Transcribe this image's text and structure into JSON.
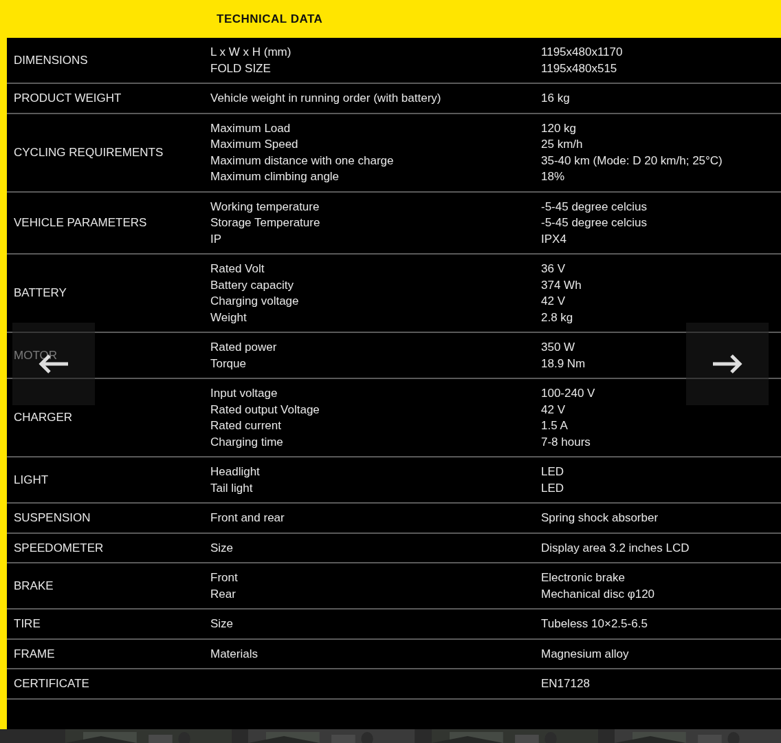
{
  "title": "TECHNICAL DATA",
  "rows": [
    {
      "label": "DIMENSIONS",
      "params": [
        "L x W x H (mm)",
        "FOLD SIZE"
      ],
      "values": [
        "1195x480x1170",
        "1195x480x515"
      ]
    },
    {
      "label": "PRODUCT WEIGHT",
      "params": [
        "Vehicle weight in running order (with battery)"
      ],
      "values": [
        "16 kg"
      ]
    },
    {
      "label": "CYCLING REQUIREMENTS",
      "params": [
        "Maximum Load",
        "Maximum Speed",
        "Maximum distance with one charge",
        "Maximum climbing angle"
      ],
      "values": [
        "120 kg",
        "25 km/h",
        "35-40 km (Mode: D 20 km/h; 25°C)",
        "18%"
      ]
    },
    {
      "label": "VEHICLE PARAMETERS",
      "params": [
        "Working temperature",
        "Storage Temperature",
        "IP"
      ],
      "values": [
        "-5-45 degree celcius",
        "-5-45 degree celcius",
        "IPX4"
      ]
    },
    {
      "label": "BATTERY",
      "params": [
        "Rated Volt",
        "Battery capacity",
        "Charging voltage",
        "Weight"
      ],
      "values": [
        "36 V",
        "374 Wh",
        "42 V",
        "2.8 kg"
      ]
    },
    {
      "label": "MOTOR",
      "params": [
        "Rated power",
        "Torque"
      ],
      "values": [
        "350 W",
        "18.9 Nm"
      ]
    },
    {
      "label": "CHARGER",
      "params": [
        "Input voltage",
        "Rated output Voltage",
        "Rated current",
        "Charging time"
      ],
      "values": [
        "100-240 V",
        "42 V",
        "1.5 A",
        "7-8 hours"
      ]
    },
    {
      "label": "LIGHT",
      "params": [
        "Headlight",
        "Tail light"
      ],
      "values": [
        "LED",
        "LED"
      ]
    },
    {
      "label": "SUSPENSION",
      "params": [
        "Front and rear"
      ],
      "values": [
        "Spring shock absorber"
      ]
    },
    {
      "label": "SPEEDOMETER",
      "params": [
        "Size"
      ],
      "values": [
        "Display area 3.2 inches LCD"
      ]
    },
    {
      "label": "BRAKE",
      "params": [
        "Front",
        "Rear"
      ],
      "values": [
        "Electronic brake",
        "Mechanical disc  φ120"
      ]
    },
    {
      "label": "TIRE",
      "params": [
        "Size"
      ],
      "values": [
        "Tubeless 10×2.5-6.5"
      ]
    },
    {
      "label": "FRAME",
      "params": [
        "Materials"
      ],
      "values": [
        "Magnesium alloy"
      ]
    },
    {
      "label": "CERTIFICATE",
      "params": [],
      "values": [
        "EN17128"
      ]
    }
  ]
}
